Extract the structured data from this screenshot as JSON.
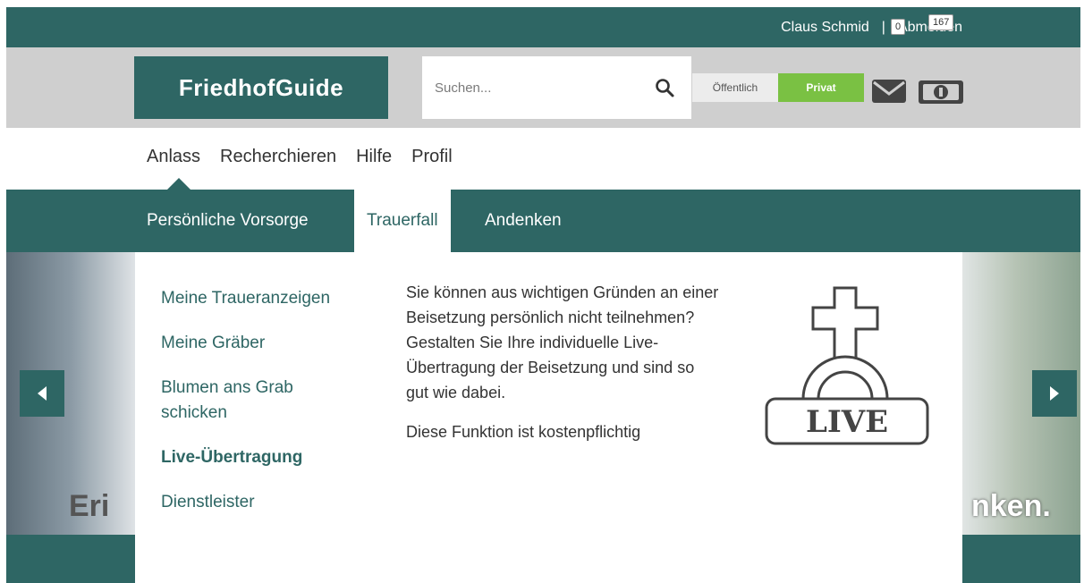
{
  "topbar": {
    "user_name": "Claus Schmid",
    "separator": "|",
    "logout_label": "Abmelden"
  },
  "header": {
    "logo_text": "FriedhofGuide",
    "search": {
      "placeholder": "Suchen...",
      "value": ""
    },
    "visibility_toggle": {
      "public_label": "Öffentlich",
      "private_label": "Privat",
      "selected": "Privat"
    },
    "mail_count": "0",
    "credits_count": "167"
  },
  "main_nav": {
    "items": [
      "Anlass",
      "Recherchieren",
      "Hilfe",
      "Profil"
    ],
    "active": "Anlass"
  },
  "sub_nav": {
    "items": [
      "Persönliche Vorsorge",
      "Trauerfall",
      "Andenken"
    ],
    "active": "Trauerfall"
  },
  "dropdown": {
    "menu_items": [
      {
        "label": "Meine Traueranzeigen",
        "bold": false
      },
      {
        "label": "Meine Gräber",
        "bold": false
      },
      {
        "label": "Blumen ans Grab schicken",
        "bold": false
      },
      {
        "label": "Live-Übertragung",
        "bold": true
      },
      {
        "label": "Dienstleister",
        "bold": false
      }
    ],
    "description": "Sie können aus wichtigen Gründen an einer Beisetzung persönlich nicht teilnehmen? Gestalten Sie Ihre individuelle Live-Übertragung der Beisetzung und sind so gut wie dabei.",
    "note": "Diese Funktion ist kostenpflichtig",
    "icon_label": "LIVE"
  },
  "hero": {
    "text_left": "Eri",
    "text_right": "nken."
  },
  "colors": {
    "primary": "#2e6664",
    "accent_green": "#7ac143",
    "header_grey": "#cfcfcf"
  }
}
